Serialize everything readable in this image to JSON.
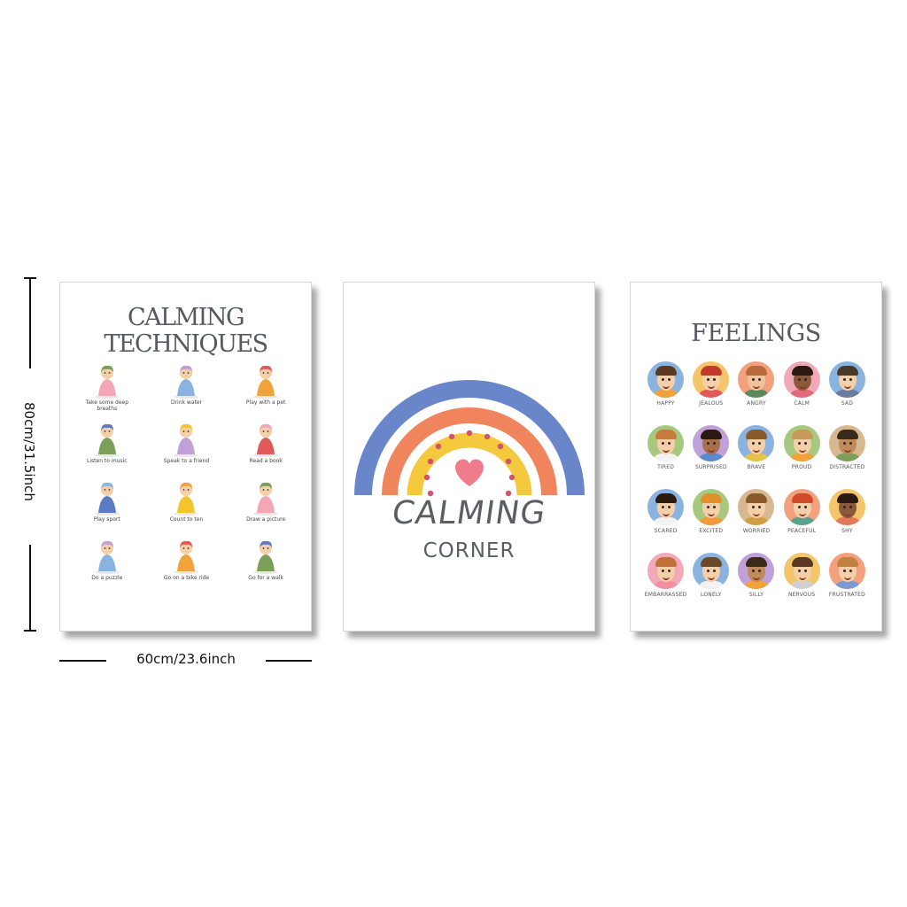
{
  "dimensions": {
    "height_label": "80cm/31.5inch",
    "width_label": "60cm/23.6inch"
  },
  "poster1": {
    "title_line1": "CALMING",
    "title_line2": "TECHNIQUES",
    "techniques": [
      {
        "label": "Take some deep breaths",
        "icon": "child-breathing-icon"
      },
      {
        "label": "Drink water",
        "icon": "child-drinking-icon"
      },
      {
        "label": "Play with a pet",
        "icon": "child-with-cat-icon"
      },
      {
        "label": "Listen to music",
        "icon": "child-headphones-icon"
      },
      {
        "label": "Speak to a friend",
        "icon": "two-children-talking-icon"
      },
      {
        "label": "Read a book",
        "icon": "child-reading-icon"
      },
      {
        "label": "Play sport",
        "icon": "child-soccer-icon"
      },
      {
        "label": "Count to ten",
        "icon": "child-counting-icon"
      },
      {
        "label": "Draw a picture",
        "icon": "child-drawing-icon"
      },
      {
        "label": "Do a puzzle",
        "icon": "child-puzzle-icon"
      },
      {
        "label": "Go on a bike ride",
        "icon": "child-bike-icon"
      },
      {
        "label": "Go for a walk",
        "icon": "children-walking-icon"
      }
    ]
  },
  "poster2": {
    "title_line1": "CALMING",
    "title_line2": "CORNER",
    "colors": {
      "blue": "#5b7cc4",
      "orange": "#ef7a4f",
      "yellow": "#f4c42c",
      "heart": "#f07b8a",
      "dots": "#d0546a"
    }
  },
  "poster3": {
    "title": "FEELINGS",
    "feelings": [
      {
        "label": "HAPPY",
        "bg": "#8ab3e0",
        "skin": "#f4cfa8",
        "hair": "#5a3a22",
        "shirt": "#f2a23a"
      },
      {
        "label": "JEALOUS",
        "bg": "#f4c56a",
        "skin": "#f4cfa8",
        "hair": "#c23b2a",
        "shirt": "#e05a5a"
      },
      {
        "label": "ANGRY",
        "bg": "#f2a07e",
        "skin": "#f1c39a",
        "hair": "#b86a3a",
        "shirt": "#5a8a5a"
      },
      {
        "label": "CALM",
        "bg": "#f1a8b8",
        "skin": "#8a5a3a",
        "hair": "#2a1a12",
        "shirt": "#e06a7a"
      },
      {
        "label": "SAD",
        "bg": "#8ab3e0",
        "skin": "#f4cfa8",
        "hair": "#4a3a2a",
        "shirt": "#6a7aa0"
      },
      {
        "label": "TIRED",
        "bg": "#a8c880",
        "skin": "#f4cfa8",
        "hair": "#c87a3a",
        "shirt": "#f2f2f2"
      },
      {
        "label": "SURPRISED",
        "bg": "#c0a0d8",
        "skin": "#a8704a",
        "hair": "#2a1a12",
        "shirt": "#5a8ad0"
      },
      {
        "label": "BRAVE",
        "bg": "#8ab3e0",
        "skin": "#f4cfa8",
        "hair": "#8a5a2a",
        "shirt": "#e6c24a"
      },
      {
        "label": "PROUD",
        "bg": "#a8c880",
        "skin": "#f4cfa8",
        "hair": "#c89a5a",
        "shirt": "#f2a23a"
      },
      {
        "label": "DISTRACTED",
        "bg": "#d8b890",
        "skin": "#c08a5a",
        "hair": "#3a2a1a",
        "shirt": "#7aa05a"
      },
      {
        "label": "SCARED",
        "bg": "#8ab3e0",
        "skin": "#f4cfa8",
        "hair": "#2a1a12",
        "shirt": "#f2f2f2"
      },
      {
        "label": "EXCITED",
        "bg": "#a8c880",
        "skin": "#f4cfa8",
        "hair": "#e0902a",
        "shirt": "#f29a3a"
      },
      {
        "label": "WORRIED",
        "bg": "#d8b890",
        "skin": "#f4cfa8",
        "hair": "#8a5a2a",
        "shirt": "#d0a040"
      },
      {
        "label": "PEACEFUL",
        "bg": "#f2a07e",
        "skin": "#f4cfa8",
        "hair": "#d04a2a",
        "shirt": "#5aa08a"
      },
      {
        "label": "SHY",
        "bg": "#f4c56a",
        "skin": "#8a5a3a",
        "hair": "#2a1a12",
        "shirt": "#e07a5a"
      },
      {
        "label": "EMBARRASSED",
        "bg": "#f1a8b8",
        "skin": "#f4cfa8",
        "hair": "#c0703a",
        "shirt": "#f290a0"
      },
      {
        "label": "LONELY",
        "bg": "#8ab3e0",
        "skin": "#f4cfa8",
        "hair": "#6a4a2a",
        "shirt": "#f2f2f2"
      },
      {
        "label": "SILLY",
        "bg": "#c0a0d8",
        "skin": "#c08a5a",
        "hair": "#3a2a1a",
        "shirt": "#f2a23a"
      },
      {
        "label": "NERVOUS",
        "bg": "#f4c56a",
        "skin": "#f4cfa8",
        "hair": "#5a3a22",
        "shirt": "#d0d0d0"
      },
      {
        "label": "FRUSTRATED",
        "bg": "#f2a07e",
        "skin": "#f4cfa8",
        "hair": "#c08040",
        "shirt": "#7a9ad0"
      }
    ]
  }
}
